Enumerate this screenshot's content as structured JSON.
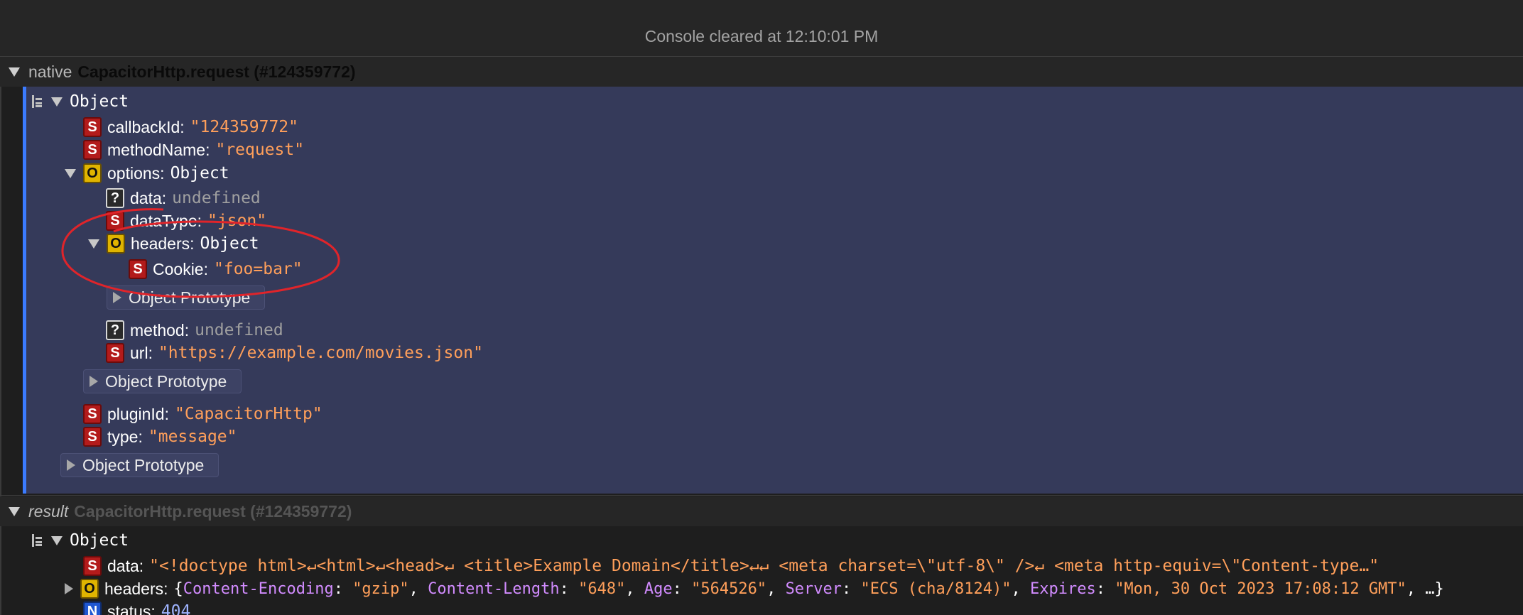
{
  "console": {
    "cleared_message": "Console cleared at 12:10:01 PM"
  },
  "native_message": {
    "kind": "native",
    "call": "CapacitorHttp.request (#124359772)",
    "root_label": "Object",
    "props": {
      "callbackId": {
        "key": "callbackId",
        "value": "\"124359772\"",
        "type": "S"
      },
      "methodName": {
        "key": "methodName",
        "value": "\"request\"",
        "type": "S"
      },
      "options": {
        "key": "options",
        "value": "Object",
        "type": "O",
        "data": {
          "key": "data",
          "value": "undefined",
          "type": "?"
        },
        "dataType": {
          "key": "dataType",
          "value": "\"json\"",
          "type": "S"
        },
        "headers": {
          "key": "headers",
          "value": "Object",
          "type": "O",
          "cookie": {
            "key": "Cookie",
            "value": "\"foo=bar\"",
            "type": "S"
          },
          "prototype": "Object Prototype"
        },
        "method": {
          "key": "method",
          "value": "undefined",
          "type": "?"
        },
        "url": {
          "key": "url",
          "value": "\"https://example.com/movies.json\"",
          "type": "S"
        },
        "prototype": "Object Prototype"
      },
      "pluginId": {
        "key": "pluginId",
        "value": "\"CapacitorHttp\"",
        "type": "S"
      },
      "type": {
        "key": "type",
        "value": "\"message\"",
        "type": "S"
      },
      "prototype": "Object Prototype"
    }
  },
  "result_message": {
    "kind": "result",
    "call": "CapacitorHttp.request (#124359772)",
    "root_label": "Object",
    "data": {
      "key": "data",
      "type": "S",
      "value": "\"<!doctype html>↵<html>↵<head>↵    <title>Example Domain</title>↵↵    <meta charset=\\\"utf-8\\\" />↵    <meta http-equiv=\\\"Content-type…\""
    },
    "headers": {
      "key": "headers",
      "type": "O",
      "open": "{",
      "pairs": [
        {
          "k": "Content-Encoding",
          "v": "\"gzip\""
        },
        {
          "k": "Content-Length",
          "v": "\"648\""
        },
        {
          "k": "Age",
          "v": "\"564526\""
        },
        {
          "k": "Server",
          "v": "\"ECS (cha/8124)\""
        },
        {
          "k": "Expires",
          "v": "\"Mon, 30 Oct 2023 17:08:12 GMT\""
        }
      ],
      "tail": "…}"
    },
    "status": {
      "key": "status",
      "type": "N",
      "value": "404"
    }
  },
  "colors": {
    "string": "#ff9f5a",
    "highlight_bg": "#353a5a",
    "highlight_accent": "#3b7bff",
    "annotation": "#e0242a"
  }
}
